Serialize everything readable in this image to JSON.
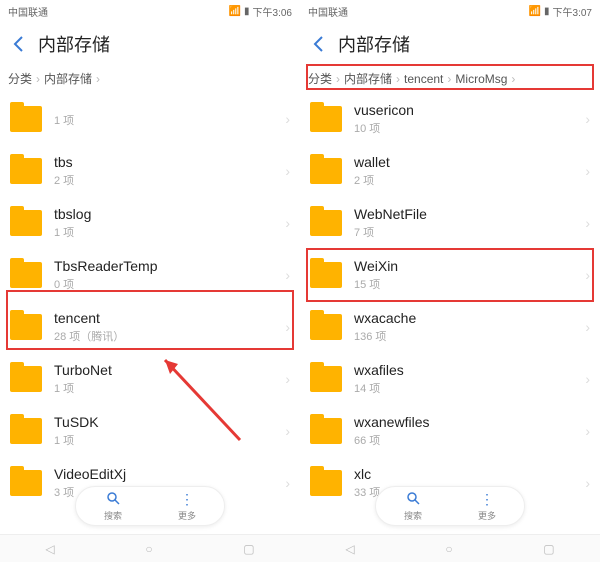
{
  "left": {
    "status": {
      "carrier": "中国联通",
      "time": "下午3:06"
    },
    "title": "内部存储",
    "breadcrumb": [
      "分类",
      "内部存储"
    ],
    "items": [
      {
        "name": "",
        "sub": "1 项"
      },
      {
        "name": "tbs",
        "sub": "2 项"
      },
      {
        "name": "tbslog",
        "sub": "1 项"
      },
      {
        "name": "TbsReaderTemp",
        "sub": "0 项"
      },
      {
        "name": "tencent",
        "sub": "28 项（腾讯）"
      },
      {
        "name": "TurboNet",
        "sub": "1 项"
      },
      {
        "name": "TuSDK",
        "sub": "1 项"
      },
      {
        "name": "VideoEditXj",
        "sub": "3 项"
      }
    ],
    "fab": {
      "search": "搜索",
      "more": "更多"
    }
  },
  "right": {
    "status": {
      "carrier": "中国联通",
      "time": "下午3:07"
    },
    "title": "内部存储",
    "breadcrumb": [
      "分类",
      "内部存储",
      "tencent",
      "MicroMsg"
    ],
    "items": [
      {
        "name": "vusericon",
        "sub": "10 项"
      },
      {
        "name": "wallet",
        "sub": "2 项"
      },
      {
        "name": "WebNetFile",
        "sub": "7 项"
      },
      {
        "name": "WeiXin",
        "sub": "15 项"
      },
      {
        "name": "wxacache",
        "sub": "136 项"
      },
      {
        "name": "wxafiles",
        "sub": "14 项"
      },
      {
        "name": "wxanewfiles",
        "sub": "66 项"
      },
      {
        "name": "xlc",
        "sub": "33 项"
      }
    ],
    "fab": {
      "search": "搜索",
      "more": "更多"
    }
  },
  "icons": {
    "back": "←",
    "chev": "›",
    "sep": "›",
    "search": "🔍",
    "more": "⋮",
    "wifi": "📶",
    "batt": "▮"
  }
}
